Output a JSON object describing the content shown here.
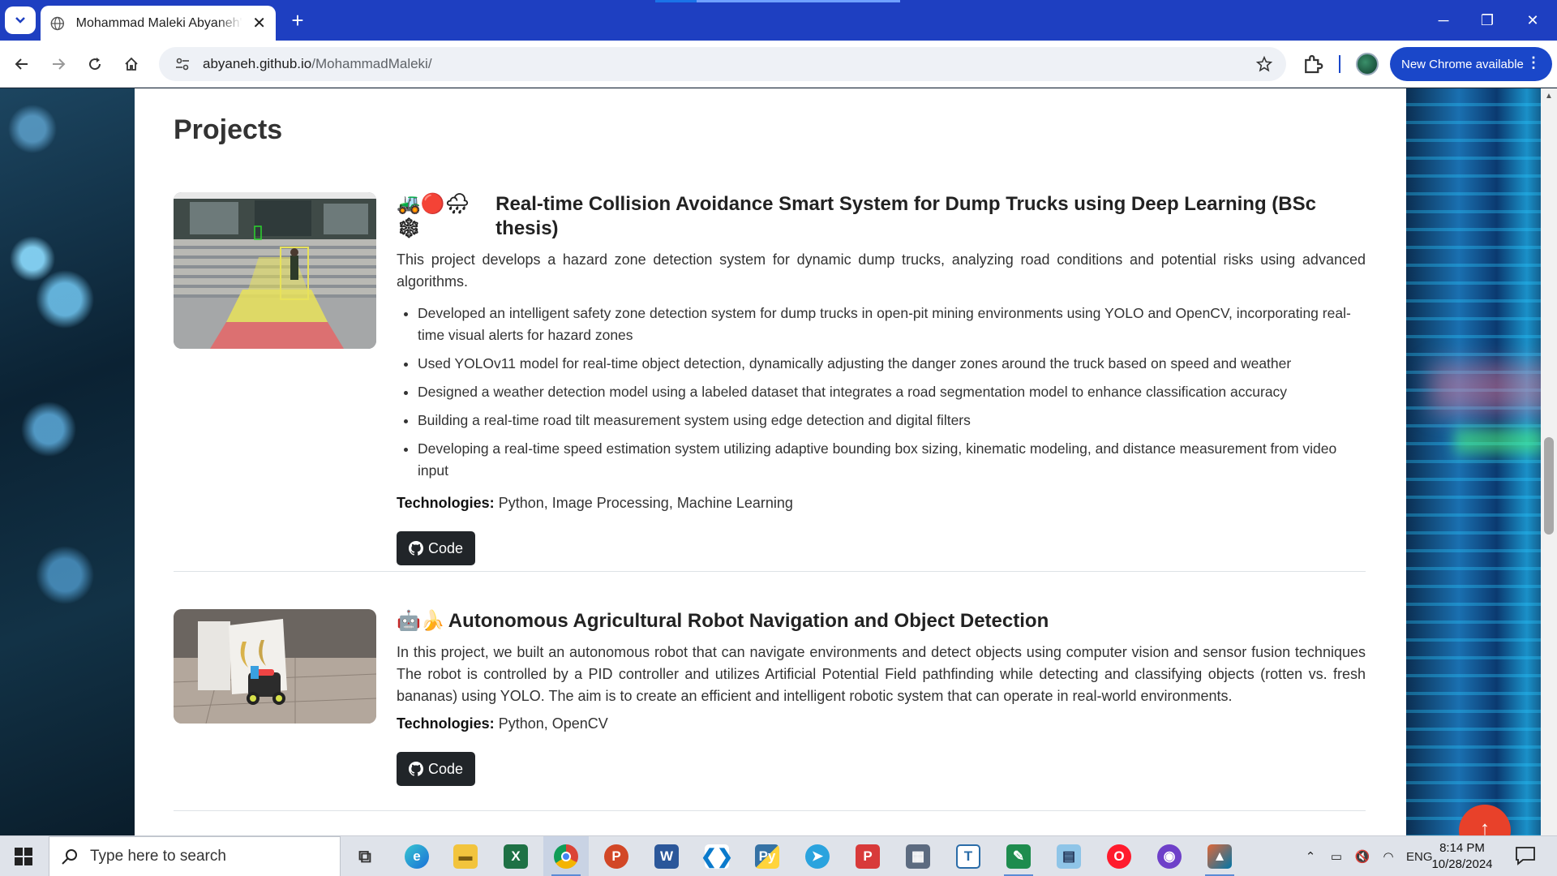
{
  "browser": {
    "tab_title": "Mohammad Maleki Abyaneh's Portfolio",
    "tab_load_progress": 0.17,
    "url_host": "abyaneh.github.io",
    "url_path": "/MohammadMaleki/",
    "update_button": "New Chrome available"
  },
  "page": {
    "section_title": "Projects",
    "projects": [
      {
        "emoji": "🚜🔴🌧❄",
        "title": "Real-time Collision Avoidance Smart System for Dump Trucks using Deep Learning (BSc thesis)",
        "description": "This project develops a hazard zone detection system for dynamic dump trucks, analyzing road conditions and potential risks using advanced algorithms.",
        "bullets": [
          "Developed an intelligent safety zone detection system for dump trucks in open-pit mining environments using YOLO and OpenCV, incorporating real-time visual alerts for hazard zones",
          "Used YOLOv11 model for real-time object detection, dynamically adjusting the danger zones around the truck based on speed and weather",
          "Designed a weather detection model using a labeled dataset that integrates a road segmentation model to enhance classification accuracy",
          "Building a real-time road tilt measurement system using edge detection and digital filters",
          "Developing a real-time speed estimation system utilizing adaptive bounding box sizing, kinematic modeling, and distance measurement from video input"
        ],
        "tech_label": "Technologies:",
        "tech": "Python, Image Processing, Machine Learning",
        "button": "Code"
      },
      {
        "emoji": "🤖🍌",
        "title": "Autonomous Agricultural Robot Navigation and Object Detection",
        "description": "In this project, we built an autonomous robot that can navigate environments and detect objects using computer vision and sensor fusion techniques The robot is controlled by a PID controller and utilizes Artificial Potential Field pathfinding while detecting and classifying objects (rotten vs. fresh bananas) using YOLO. The aim is to create an efficient and intelligent robotic system that can operate in real-world environments.",
        "tech_label": "Technologies:",
        "tech": "Python, OpenCV",
        "button": "Code"
      }
    ]
  },
  "taskbar": {
    "search_placeholder": "Type here to search",
    "apps": [
      "task-view",
      "edge",
      "file-explorer",
      "excel",
      "chrome",
      "powerpoint",
      "word",
      "vscode",
      "python",
      "telegram",
      "pomodoro",
      "calculator",
      "typora",
      "cursor",
      "notepad",
      "opera",
      "github-desktop",
      "matlab"
    ],
    "language": "ENG",
    "time": "8:14 PM",
    "date": "10/28/2024"
  }
}
